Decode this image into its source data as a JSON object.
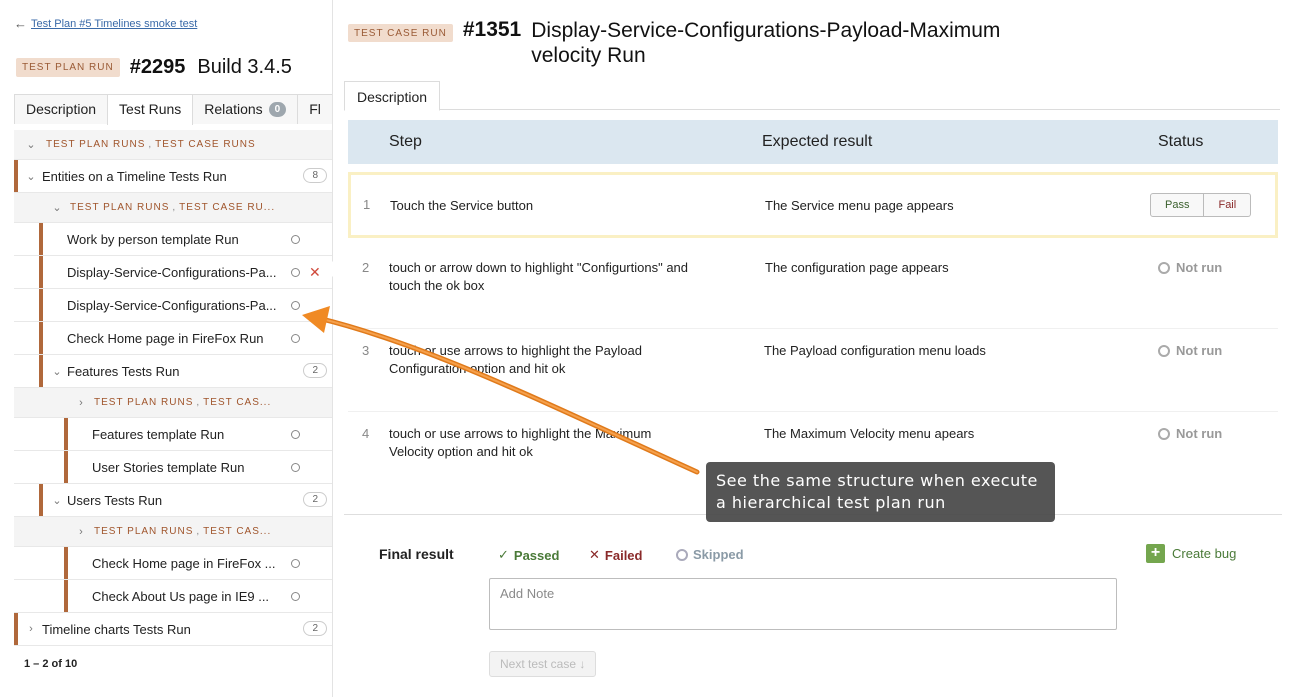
{
  "left": {
    "back_arrow": "←",
    "back_link": "Test Plan #5 Timelines smoke test",
    "plan_tag": "TEST PLAN RUN",
    "plan_number": "#2295",
    "plan_build": "Build 3.4.5",
    "tabs": [
      {
        "label": "Description"
      },
      {
        "label": "Test Runs"
      },
      {
        "label": "Relations",
        "badge": "0"
      },
      {
        "label": "Fl"
      }
    ],
    "subs_tpr": "TEST PLAN RUNS",
    "subs_tcr": "TEST CASE RUNS",
    "subs_tcr_short1": "TEST CASE RU...",
    "subs_tcr_short2": "TEST CAS...",
    "comma": ",",
    "groups": [
      {
        "label": "Entities on a Timeline Tests Run",
        "count": "8"
      },
      {
        "label": "Features Tests Run",
        "count": "2"
      },
      {
        "label": "Users Tests Run",
        "count": "2"
      },
      {
        "label": "Timeline charts Tests Run",
        "count": "2"
      }
    ],
    "items": [
      "Work by person template Run",
      "Display-Service-Configurations-Pa...",
      "Display-Service-Configurations-Pa...",
      "Check Home page in FireFox Run",
      "Features template Run",
      "User Stories template Run",
      "Check Home page in FireFox ...",
      "Check About Us page in IE9 ..."
    ],
    "pager": "1 – 2 of 10"
  },
  "main": {
    "tag": "TEST CASE RUN",
    "number": "#1351",
    "title": "Display-Service-Configurations-Payload-Maximum velocity Run",
    "tab": "Description",
    "cols": {
      "step": "Step",
      "expected": "Expected result",
      "status": "Status"
    },
    "steps": [
      {
        "n": "1",
        "step": "Touch the Service button",
        "expected": "The Service menu page appears",
        "pass": "Pass",
        "fail": "Fail"
      },
      {
        "n": "2",
        "step": "touch or arrow down to highlight \"Configurtions\" and touch the ok box",
        "expected": "The configuration page appears",
        "status": "Not run"
      },
      {
        "n": "3",
        "step": "touch or use arrows to highlight the Payload Configuration option and hit ok",
        "expected": "The Payload configuration menu loads",
        "status": "Not run"
      },
      {
        "n": "4",
        "step": "touch or use arrows to highlight the Maximum Velocity option and hit ok",
        "expected": "The Maximum Velocity menu apears",
        "status": "Not run"
      }
    ],
    "final_label": "Final result",
    "passed": "Passed",
    "failed": "Failed",
    "skipped": "Skipped",
    "create_bug": "Create bug",
    "note_placeholder": "Add Note",
    "next": "Next test case ↓"
  },
  "callout": "See the same structure when execute a hierarchical test plan run",
  "colors": {
    "accent": "#b0683b",
    "header_bg": "#dbe7f0",
    "arrow": "#f08a24"
  }
}
